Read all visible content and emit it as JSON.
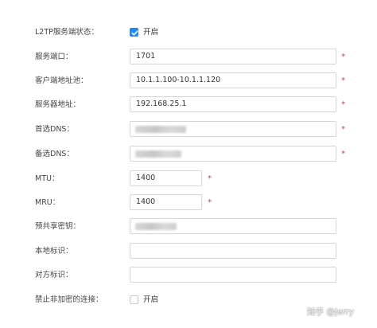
{
  "fields": {
    "l2tp_status": {
      "label": "L2TP服务端状态：",
      "checkbox_label": "开启",
      "checked": true
    },
    "service_port": {
      "label": "服务端口：",
      "value": "1701",
      "required_mark": "*"
    },
    "client_pool": {
      "label": "客户端地址池：",
      "value": "10.1.1.100-10.1.1.120",
      "required_mark": "*"
    },
    "server_address": {
      "label": "服务器地址：",
      "value": "192.168.25.1",
      "required_mark": "*"
    },
    "primary_dns": {
      "label": "首选DNS：",
      "required_mark": "*"
    },
    "secondary_dns": {
      "label": "备选DNS：",
      "required_mark": "*"
    },
    "mtu": {
      "label": "MTU：",
      "value": "1400",
      "required_mark": "*"
    },
    "mru": {
      "label": "MRU：",
      "value": "1400",
      "required_mark": "*"
    },
    "psk": {
      "label": "预共享密钥："
    },
    "local_id": {
      "label": "本地标识：",
      "value": ""
    },
    "peer_id": {
      "label": "对方标识：",
      "value": ""
    },
    "block_unencrypted": {
      "label": "禁止非加密的连接：",
      "checkbox_label": "开启",
      "checked": false
    }
  },
  "watermark": "知乎 @jerry",
  "colors": {
    "accent": "#1a8cff",
    "required": "#e4393c",
    "border": "#d6d6d6"
  },
  "icons": {
    "checkmark": "checkmark-icon"
  }
}
